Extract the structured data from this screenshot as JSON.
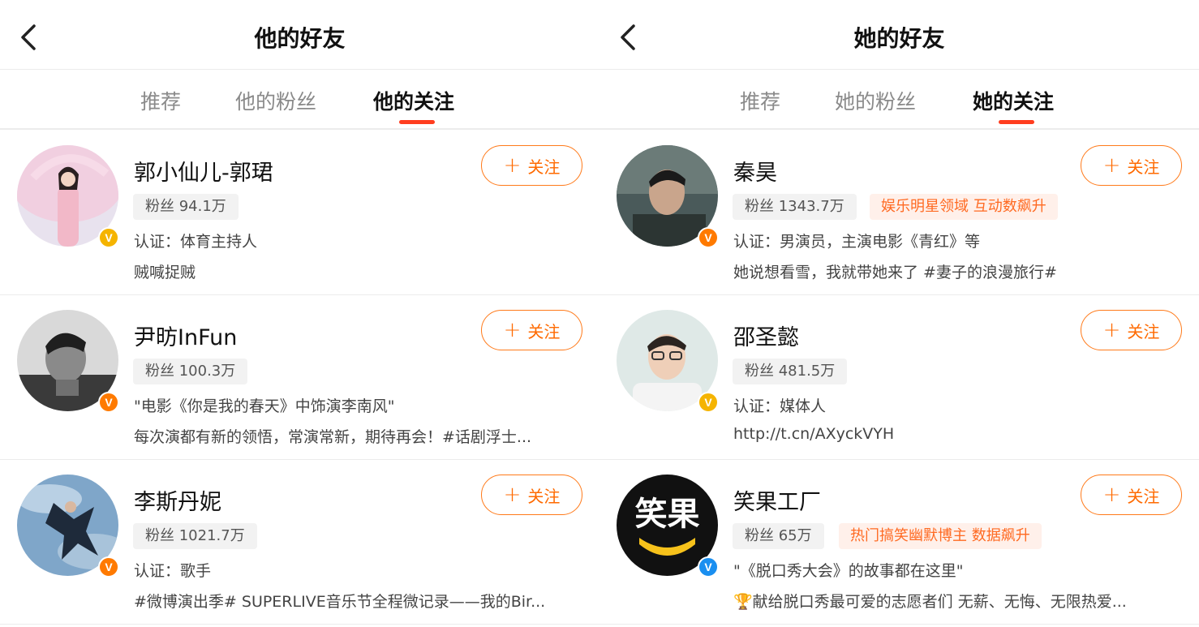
{
  "screens": [
    {
      "title": "他的好友",
      "tabs": [
        "推荐",
        "他的粉丝",
        "他的关注"
      ],
      "active_tab_index": 2,
      "follow_label": "关注",
      "users": [
        {
          "name": "郭小仙儿-郭珺",
          "fans": "粉丝 94.1万",
          "tag": "",
          "line1": "认证：体育主持人",
          "line2": "贼喊捉贼",
          "badge": "gold",
          "avatar_icon": "woman-in-pink-photo"
        },
        {
          "name": "尹昉InFun",
          "fans": "粉丝 100.3万",
          "tag": "",
          "line1": "\"电影《你是我的春天》中饰演李南风\"",
          "line2": "每次演都有新的领悟，常演常新，期待再会！#话剧浮士...",
          "badge": "orange",
          "avatar_icon": "man-bw-portrait"
        },
        {
          "name": "李斯丹妮",
          "fans": "粉丝 1021.7万",
          "tag": "",
          "line1": "认证：歌手",
          "line2": "#微博演出季# SUPERLIVE音乐节全程微记录——我的Bir...",
          "badge": "orange",
          "avatar_icon": "jumping-person-sky-photo"
        }
      ]
    },
    {
      "title": "她的好友",
      "tabs": [
        "推荐",
        "她的粉丝",
        "她的关注"
      ],
      "active_tab_index": 2,
      "follow_label": "关注",
      "users": [
        {
          "name": "秦昊",
          "fans": "粉丝 1343.7万",
          "tag": "娱乐明星领域 互动数飙升",
          "line1": "认证：男演员，主演电影《青红》等",
          "line2": "她说想看雪，我就带她来了 #妻子的浪漫旅行#",
          "badge": "orange",
          "avatar_icon": "man-portrait-photo"
        },
        {
          "name": "邵圣懿",
          "fans": "粉丝 481.5万",
          "tag": "",
          "line1": "认证：媒体人",
          "line2": "http://t.cn/AXyckVYH",
          "badge": "gold",
          "avatar_icon": "man-glasses-photo"
        },
        {
          "name": "笑果工厂",
          "fans": "粉丝 65万",
          "tag": "热门搞笑幽默博主 数据飙升",
          "line1": "\"《脱口秀大会》的故事都在这里\"",
          "line2": "🏆献给脱口秀最可爱的志愿者们 无薪、无悔、无限热爱...",
          "badge": "blue",
          "avatar_icon": "xiaoguo-logo",
          "avatar_logo_text": "笑果"
        }
      ]
    }
  ],
  "colors": {
    "accent": "#ff6a00",
    "tab_indicator": "#ff3d1f",
    "tag_text": "#ff6a22",
    "tag_bg": "#fff0ea",
    "badge_gold": "#f5b400",
    "badge_orange": "#ff7a00",
    "badge_blue": "#1a8ff0"
  }
}
